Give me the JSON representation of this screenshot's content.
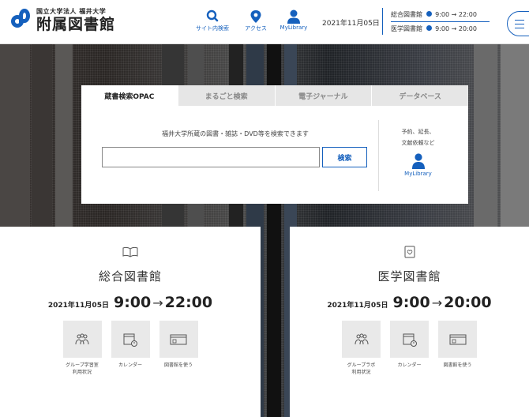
{
  "header": {
    "logo_small": "国立大学法人 福井大学",
    "logo_big": "附属図書館",
    "nav": [
      {
        "label": "サイト内検索",
        "icon": "search-icon"
      },
      {
        "label": "アクセス",
        "icon": "map-pin-icon"
      },
      {
        "label": "MyLibrary",
        "icon": "user-icon"
      }
    ],
    "date": "2021年11月05日",
    "hours": [
      {
        "name": "総合図書館",
        "open": "9:00",
        "arrow": "→",
        "close": "22:00"
      },
      {
        "name": "医学図書館",
        "open": "9:00",
        "arrow": "→",
        "close": "20:00"
      }
    ]
  },
  "search": {
    "tabs": [
      "蔵書検索OPAC",
      "まるごと検索",
      "電子ジャーナル",
      "データベース"
    ],
    "description": "福井大学所蔵の図書・雑誌・DVD等を検索できます",
    "input_value": "",
    "button_label": "検索",
    "side_note_1": "予約、延長、",
    "side_note_2": "文献依頼など",
    "side_link": "MyLibrary"
  },
  "libraries": [
    {
      "title": "総合図書館",
      "date": "2021年11月05日",
      "open": "9:00",
      "arrow": "→",
      "close": "22:00",
      "links": [
        "グループ学習室\n利用状況",
        "カレンダー",
        "図書館を使う"
      ]
    },
    {
      "title": "医学図書館",
      "date": "2021年11月05日",
      "open": "9:00",
      "arrow": "→",
      "close": "20:00",
      "links": [
        "グループラボ\n利用状況",
        "カレンダー",
        "図書館を使う"
      ]
    }
  ],
  "colors": {
    "accent": "#1560bd"
  }
}
